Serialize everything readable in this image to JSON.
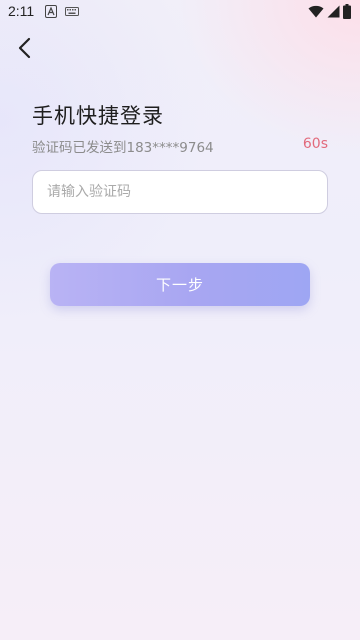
{
  "status_bar": {
    "time": "2:11",
    "icons": [
      "a-notification-icon",
      "keyboard-icon",
      "wifi-icon",
      "signal-icon",
      "battery-icon"
    ]
  },
  "header": {
    "back_icon": "chevron-left-icon"
  },
  "login": {
    "title": "手机快捷登录",
    "sent_message": "验证码已发送到183****9764",
    "countdown": "60s",
    "code_placeholder": "请输入验证码",
    "code_value": "",
    "next_label": "下一步"
  },
  "colors": {
    "accent": "#a8a6f2",
    "countdown": "#e26a7c",
    "title": "#1e1e1e",
    "subtitle": "#8c8c8c"
  }
}
